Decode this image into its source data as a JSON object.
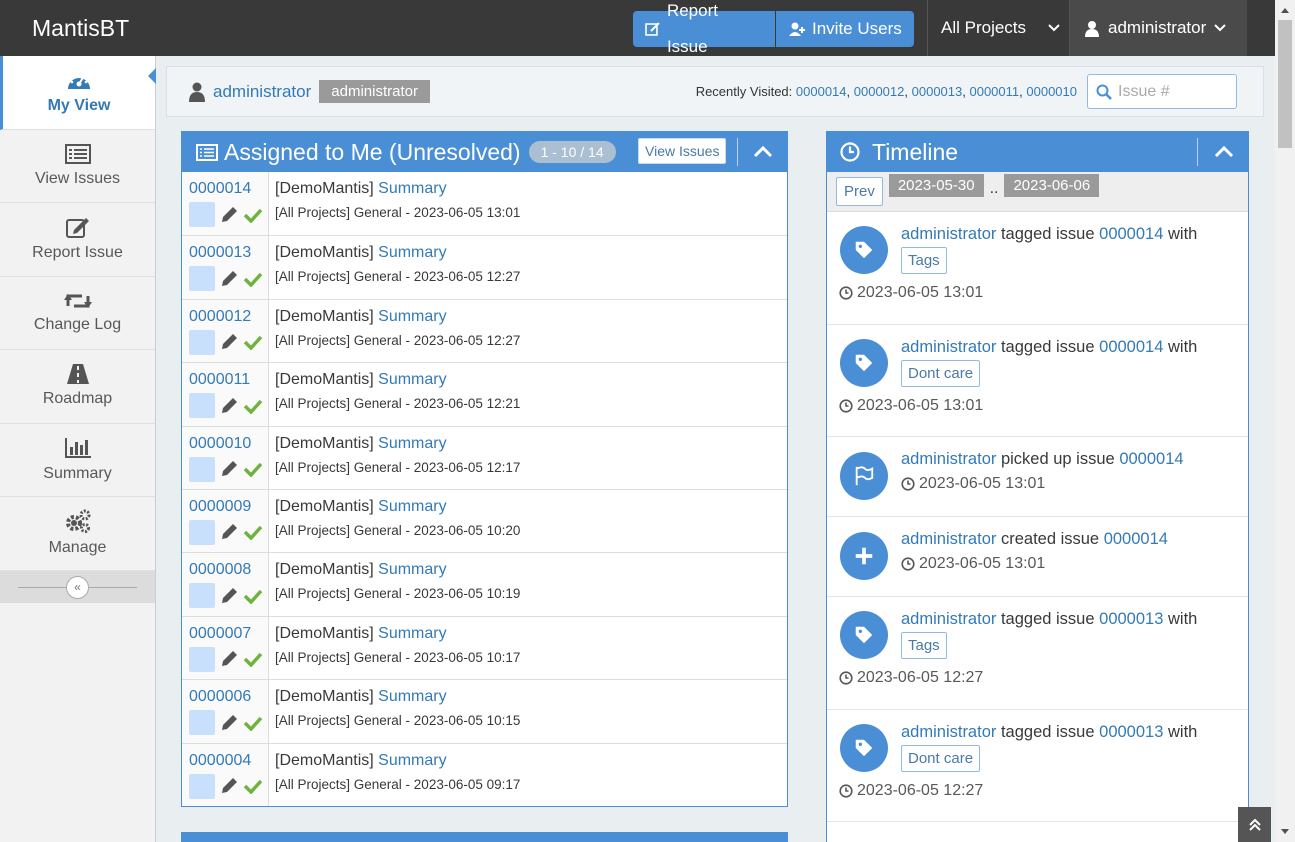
{
  "navbar": {
    "brand": "MantisBT",
    "report_issue": "Report Issue",
    "invite_users": "Invite Users",
    "project_selector": "All Projects",
    "user_menu": "administrator"
  },
  "sidebar": {
    "items": [
      {
        "label": "My View",
        "icon": "dashboard-icon"
      },
      {
        "label": "View Issues",
        "icon": "list-icon"
      },
      {
        "label": "Report Issue",
        "icon": "edit-icon"
      },
      {
        "label": "Change Log",
        "icon": "retweet-icon"
      },
      {
        "label": "Roadmap",
        "icon": "road-icon"
      },
      {
        "label": "Summary",
        "icon": "bar-chart-icon"
      },
      {
        "label": "Manage",
        "icon": "gears-icon"
      }
    ]
  },
  "breadcrumb": {
    "user": "administrator",
    "badge": "administrator",
    "recent_label": "Recently Visited:",
    "recent": [
      "0000014",
      "0000012",
      "0000013",
      "0000011",
      "0000010"
    ],
    "search_placeholder": "Issue #"
  },
  "assigned": {
    "title": "Assigned to Me (Unresolved)",
    "count": "1 - 10 / 14",
    "view_issues": "View Issues",
    "rows": [
      {
        "id": "0000014",
        "project": "[DemoMantis]",
        "summary": "Summary",
        "meta": "[All Projects] General - 2023-06-05 13:01"
      },
      {
        "id": "0000013",
        "project": "[DemoMantis]",
        "summary": "Summary",
        "meta": "[All Projects] General - 2023-06-05 12:27"
      },
      {
        "id": "0000012",
        "project": "[DemoMantis]",
        "summary": "Summary",
        "meta": "[All Projects] General - 2023-06-05 12:27"
      },
      {
        "id": "0000011",
        "project": "[DemoMantis]",
        "summary": "Summary",
        "meta": "[All Projects] General - 2023-06-05 12:21"
      },
      {
        "id": "0000010",
        "project": "[DemoMantis]",
        "summary": "Summary",
        "meta": "[All Projects] General - 2023-06-05 12:17"
      },
      {
        "id": "0000009",
        "project": "[DemoMantis]",
        "summary": "Summary",
        "meta": "[All Projects] General - 2023-06-05 10:20"
      },
      {
        "id": "0000008",
        "project": "[DemoMantis]",
        "summary": "Summary",
        "meta": "[All Projects] General - 2023-06-05 10:19"
      },
      {
        "id": "0000007",
        "project": "[DemoMantis]",
        "summary": "Summary",
        "meta": "[All Projects] General - 2023-06-05 10:17"
      },
      {
        "id": "0000006",
        "project": "[DemoMantis]",
        "summary": "Summary",
        "meta": "[All Projects] General - 2023-06-05 10:15"
      },
      {
        "id": "0000004",
        "project": "[DemoMantis]",
        "summary": "Summary",
        "meta": "[All Projects] General - 2023-06-05 09:17"
      }
    ]
  },
  "timeline": {
    "title": "Timeline",
    "prev": "Prev",
    "date_from": "2023-05-30",
    "date_sep": "..",
    "date_to": "2023-06-06",
    "entries": [
      {
        "icon": "tag-icon",
        "user": "administrator",
        "action": "tagged issue",
        "issue": "0000014",
        "suffix": "with",
        "tag": "Tags",
        "time": "2023-06-05 13:01"
      },
      {
        "icon": "tag-icon",
        "user": "administrator",
        "action": "tagged issue",
        "issue": "0000014",
        "suffix": "with",
        "tag": "Dont care",
        "time": "2023-06-05 13:01"
      },
      {
        "icon": "flag-icon",
        "user": "administrator",
        "action": "picked up issue",
        "issue": "0000014",
        "suffix": "",
        "tag": "",
        "time": "2023-06-05 13:01"
      },
      {
        "icon": "plus-icon",
        "user": "administrator",
        "action": "created issue",
        "issue": "0000014",
        "suffix": "",
        "tag": "",
        "time": "2023-06-05 13:01"
      },
      {
        "icon": "tag-icon",
        "user": "administrator",
        "action": "tagged issue",
        "issue": "0000013",
        "suffix": "with",
        "tag": "Tags",
        "time": "2023-06-05 12:27"
      },
      {
        "icon": "tag-icon",
        "user": "administrator",
        "action": "tagged issue",
        "issue": "0000013",
        "suffix": "with",
        "tag": "Dont care",
        "time": "2023-06-05 12:27"
      }
    ]
  },
  "colors": {
    "primary": "#4a8fd6",
    "navbar": "#393939",
    "link": "#337ab7",
    "check": "#6fb33f"
  }
}
